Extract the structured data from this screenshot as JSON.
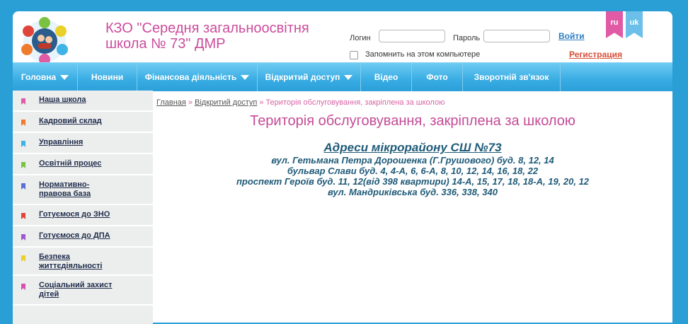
{
  "header": {
    "title": "КЗО \"Середня загальноосвітня школа № 73\" ДМР",
    "login_label": "Логин",
    "password_label": "Пароль",
    "login_button": "Войти",
    "remember_label": "Запомнить на этом компьютере",
    "register_link": "Регистрация",
    "lang_ru": "ru",
    "lang_uk": "uk"
  },
  "nav": [
    {
      "label": "Головна",
      "dropdown": true
    },
    {
      "label": "Новини",
      "dropdown": false
    },
    {
      "label": "Фінансова діяльність",
      "dropdown": true
    },
    {
      "label": "Відкритий доступ",
      "dropdown": true
    },
    {
      "label": "Відео",
      "dropdown": false
    },
    {
      "label": "Фото",
      "dropdown": false
    },
    {
      "label": "Зворотній зв'язок",
      "dropdown": false
    }
  ],
  "sidebar": [
    {
      "label": "Наша школа",
      "color": "#e05aa6"
    },
    {
      "label": "Кадровий склад",
      "color": "#f07b2c"
    },
    {
      "label": "Управління",
      "color": "#3fb2e6"
    },
    {
      "label": "Освітній процес",
      "color": "#7cc242"
    },
    {
      "label": "Нормативно-правова база",
      "color": "#5b6fd6"
    },
    {
      "label": "Готуємося до ЗНО",
      "color": "#e0443a"
    },
    {
      "label": "Готуємося до ДПА",
      "color": "#9b59d0"
    },
    {
      "label": "Безпека життєдіяльності",
      "color": "#e9d12a"
    },
    {
      "label": "Соціальний захист дітей",
      "color": "#d64fb1"
    }
  ],
  "breadcrumb": {
    "home": "Главная",
    "section": "Відкритий доступ",
    "current": "Територія обслуговування, закріплена за школою"
  },
  "main": {
    "title": "Територія обслуговування, закріплена за школою",
    "addresses_heading": "Адреси мікрорайону СШ №73",
    "addresses": [
      "вул. Гетьмана Петра Дорошенка (Г.Грушового) буд. 8, 12, 14",
      "бульвар Слави буд. 4, 4-А,  6, 6-А,  8,  10,  12,  14,  16,  18,  22",
      "проспект Героїв буд. 11, 12(від 398 квартири)  14-А,  15,  17,  18, 18-А,  19,  20,  12",
      "вул. Мандриківська буд. 336, 338, 340"
    ]
  }
}
